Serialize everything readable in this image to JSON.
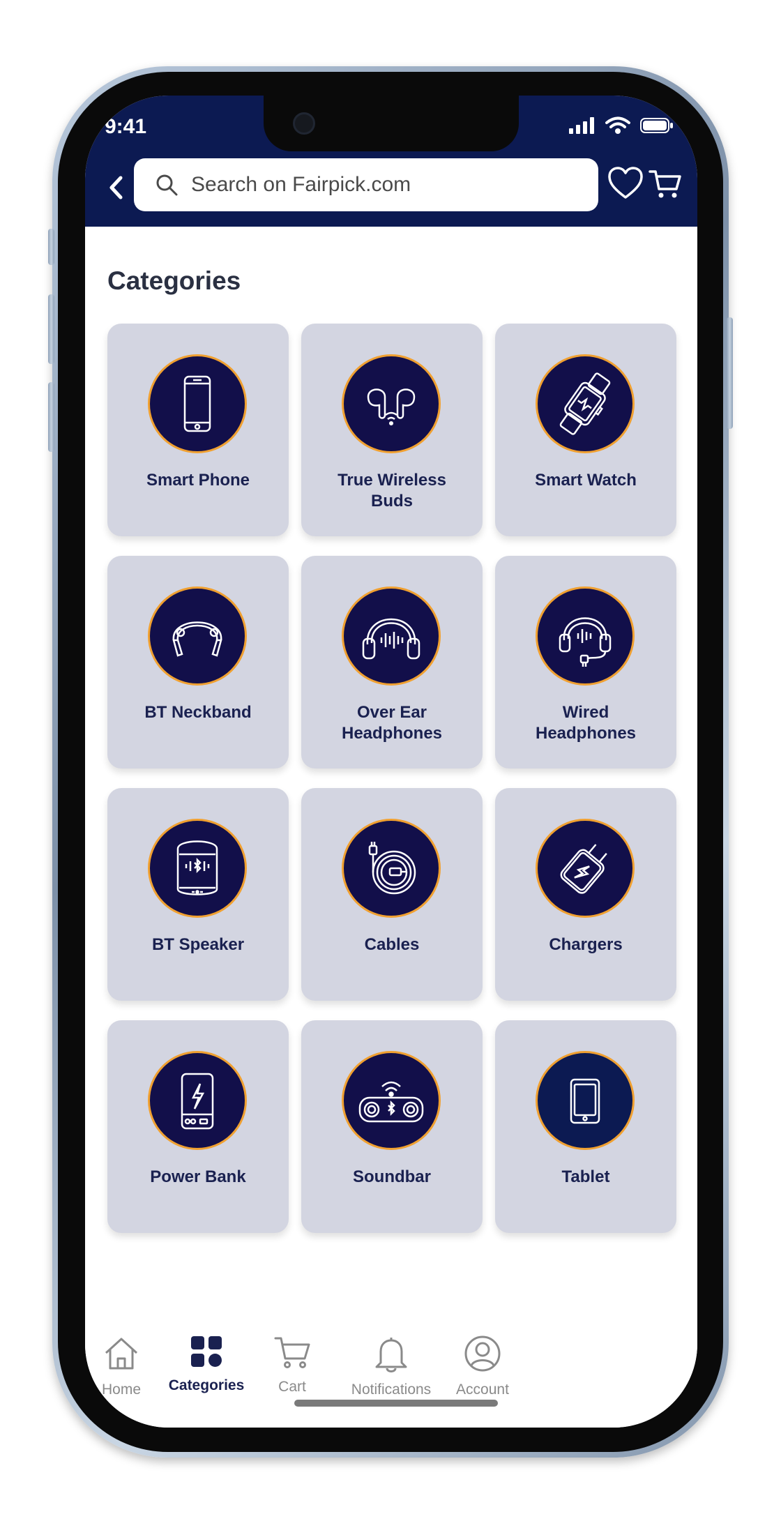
{
  "status": {
    "time": "9:41"
  },
  "search": {
    "placeholder": "Search on Fairpick.com"
  },
  "page": {
    "title": "Categories"
  },
  "categories": [
    {
      "label_lines": [
        "Smart Phone"
      ],
      "icon": "smartphone-icon"
    },
    {
      "label_lines": [
        "True Wireless",
        "Buds"
      ],
      "icon": "earbuds-icon"
    },
    {
      "label_lines": [
        "Smart Watch"
      ],
      "icon": "smartwatch-icon"
    },
    {
      "label_lines": [
        "BT Neckband"
      ],
      "icon": "neckband-icon"
    },
    {
      "label_lines": [
        "Over Ear",
        "Headphones"
      ],
      "icon": "headphones-icon"
    },
    {
      "label_lines": [
        "Wired",
        "Headphones"
      ],
      "icon": "wired-headphones-icon"
    },
    {
      "label_lines": [
        "BT Speaker"
      ],
      "icon": "speaker-icon"
    },
    {
      "label_lines": [
        "Cables"
      ],
      "icon": "cable-icon"
    },
    {
      "label_lines": [
        "Chargers"
      ],
      "icon": "charger-icon"
    },
    {
      "label_lines": [
        "Power Bank"
      ],
      "icon": "power-bank-icon"
    },
    {
      "label_lines": [
        "Soundbar"
      ],
      "icon": "soundbar-icon"
    },
    {
      "label_lines": [
        "Tablet"
      ],
      "icon": "tablet-icon"
    }
  ],
  "tabs": [
    {
      "label": "Home",
      "icon": "home-icon",
      "active": false
    },
    {
      "label": "Categories",
      "icon": "categories-icon",
      "active": true
    },
    {
      "label": "Cart",
      "icon": "cart-icon",
      "active": false
    },
    {
      "label": "Notifications",
      "icon": "bell-icon",
      "active": false
    },
    {
      "label": "Account",
      "icon": "account-icon",
      "active": false
    }
  ],
  "colors": {
    "header_bg": "#0c1a52",
    "card_bg": "#d3d5e1",
    "icon_circle": "#120f4a",
    "icon_ring": "#f0a030",
    "active_tab": "#1a2150",
    "inactive_tab": "#8a8a8a"
  }
}
